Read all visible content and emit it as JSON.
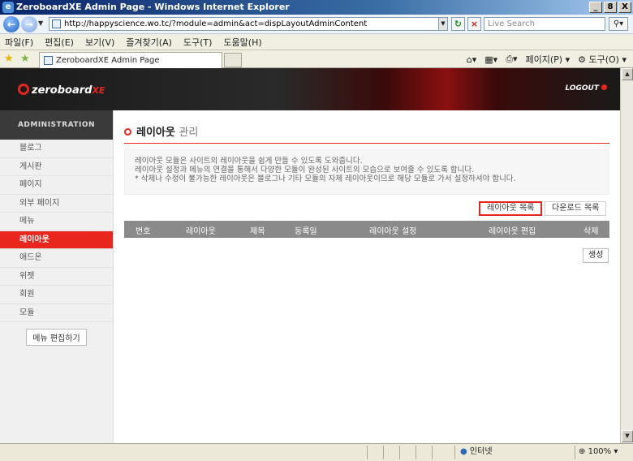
{
  "window": {
    "title": "ZeroboardXE Admin Page - Windows Internet Explorer",
    "min": "_",
    "max": "8",
    "close": "X"
  },
  "browser": {
    "url": "http://happyscience.wo.tc/?module=admin&act=dispLayoutAdminContent",
    "search_placeholder": "Live Search",
    "menu": [
      "파일(F)",
      "편집(E)",
      "보기(V)",
      "즐겨찾기(A)",
      "도구(T)",
      "도움말(H)"
    ],
    "tab_title": "ZeroboardXE Admin Page",
    "commands": {
      "page": "페이지(P)",
      "tools": "도구(O)"
    },
    "status": {
      "zone": "인터넷",
      "zoom": "100%"
    }
  },
  "xe": {
    "logo": "zeroboard",
    "logo_suffix": "XE",
    "logout": "LOGOUT"
  },
  "sidebar": {
    "heading": "ADMINISTRATION",
    "items": [
      {
        "label": "블로그"
      },
      {
        "label": "게시판"
      },
      {
        "label": "페이지"
      },
      {
        "label": "외부 페이지"
      },
      {
        "label": "메뉴"
      },
      {
        "label": "레이아웃",
        "active": true
      },
      {
        "label": "애드온"
      },
      {
        "label": "위젯"
      },
      {
        "label": "회원"
      },
      {
        "label": "모듈"
      }
    ],
    "edit_button": "메뉴 편집하기"
  },
  "main": {
    "title": "레이아웃",
    "title_sub": "관리",
    "info": [
      "레이아웃 모듈은 사이트의 레이아웃을 쉽게 만들 수 있도록 도와줍니다.",
      "레이아웃 설정과 메뉴의 연결을 통해서 다양한 모듈이 완성된 사이트의 모습으로 보여줄 수 있도록 합니다.",
      "* 삭제나 수정이 불가능한 레이아웃은 블로그나 기타 모듈의 자체 레이아웃이므로 해당 모듈로 가서 설정하셔야 합니다."
    ],
    "buttons": {
      "layout_list": "레이아웃 목록",
      "download_list": "다운로드 목록",
      "create": "생성"
    },
    "columns": [
      "번호",
      "레이아웃",
      "제목",
      "등록일",
      "레이아웃 설정",
      "레이아웃 편집",
      "삭제"
    ],
    "accent_color": "#e8261e"
  }
}
